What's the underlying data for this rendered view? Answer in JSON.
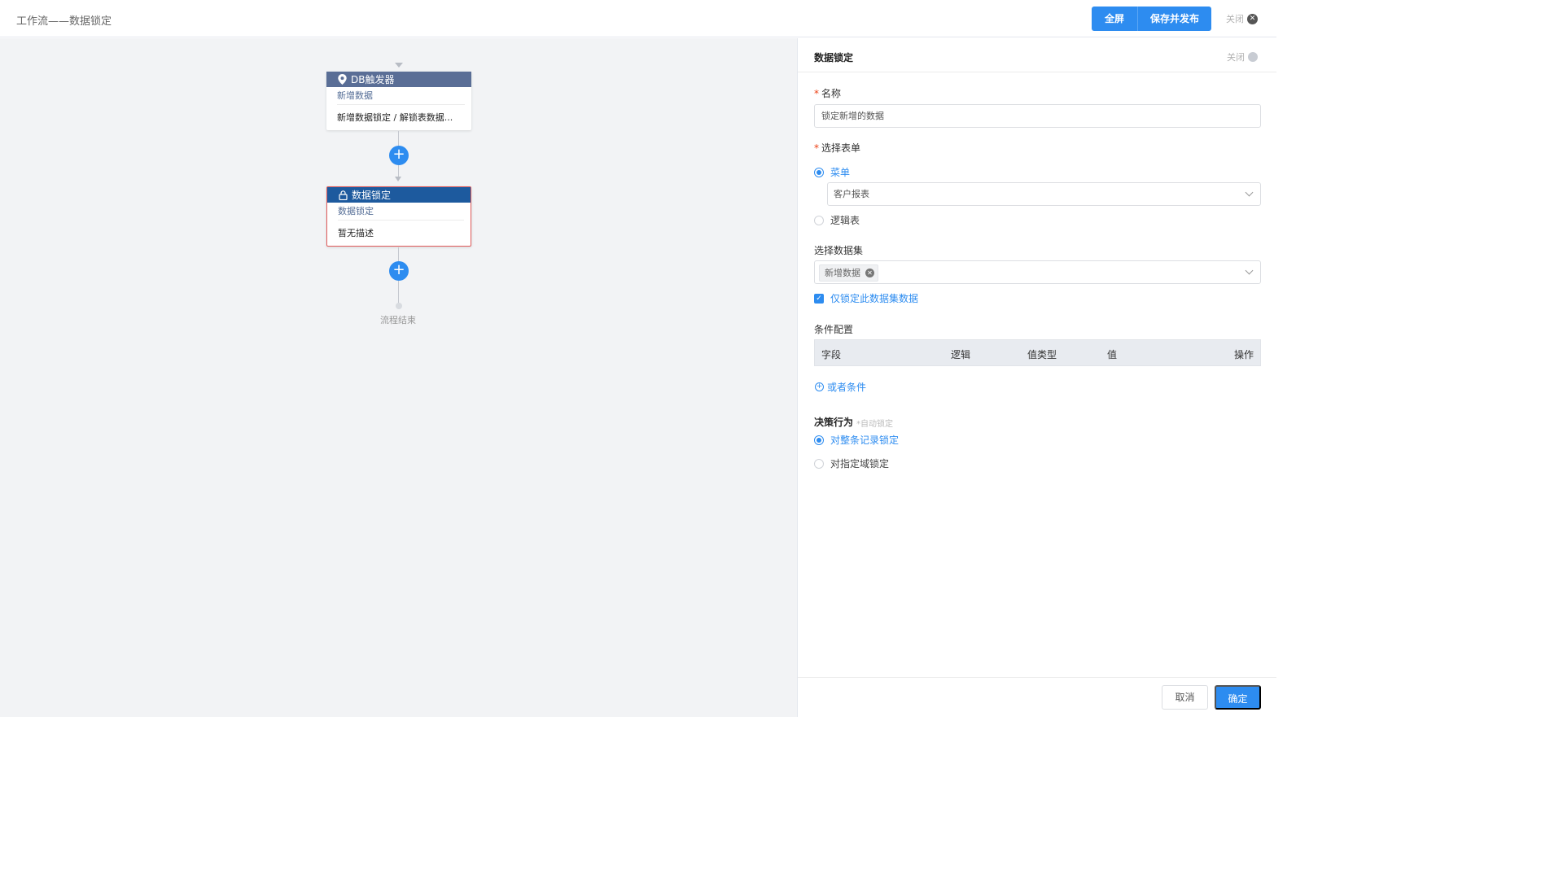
{
  "header": {
    "title": "工作流——数据锁定",
    "fullscreen_label": "全屏",
    "save_publish_label": "保存并发布",
    "close_label": "关闭"
  },
  "flow": {
    "trigger_node": {
      "title": "DB触发器",
      "subtitle": "新增数据",
      "description": "新增数据锁定 / 解锁表数据..."
    },
    "lock_node": {
      "title": "数据锁定",
      "subtitle": "数据锁定",
      "description": "暂无描述"
    },
    "end_label": "流程结束"
  },
  "panel": {
    "title": "数据锁定",
    "close_label": "关闭",
    "name": {
      "label": "名称",
      "value": "锁定新增的数据"
    },
    "form": {
      "label": "选择表单",
      "options": [
        {
          "label": "菜单",
          "selected": true
        },
        {
          "label": "逻辑表",
          "selected": false
        }
      ],
      "menu_value": "客户报表"
    },
    "dataset": {
      "label": "选择数据集",
      "tag": "新增数据",
      "only_lock_label": "仅锁定此数据集数据",
      "only_lock_checked": true
    },
    "conditions": {
      "label": "条件配置",
      "columns": [
        "字段",
        "逻辑",
        "值类型",
        "值",
        "操作"
      ],
      "or_condition_label": "或者条件"
    },
    "decision": {
      "label": "决策行为",
      "hint": "*自动锁定",
      "options": [
        {
          "label": "对整条记录锁定",
          "selected": true
        },
        {
          "label": "对指定域锁定",
          "selected": false
        }
      ]
    },
    "footer": {
      "cancel_label": "取消",
      "confirm_label": "确定"
    }
  },
  "colors": {
    "accent": "#2d8cf0",
    "trigger_header": "#5a6e96",
    "lock_header": "#1d5a9e",
    "lock_border": "#e05a5a",
    "canvas_bg": "#f2f3f5"
  }
}
